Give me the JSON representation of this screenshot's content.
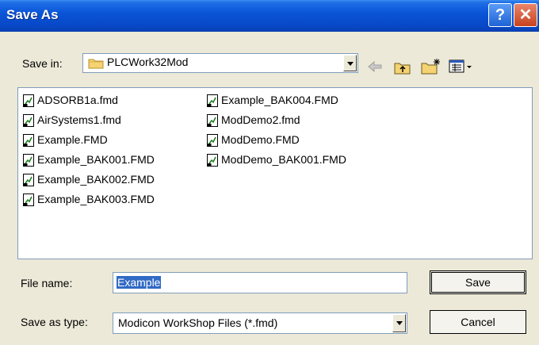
{
  "title": "Save As",
  "titlebar": {
    "help_glyph": "?",
    "close_glyph": "✕"
  },
  "save_in": {
    "label": "Save in:",
    "value": "PLCWork32Mod"
  },
  "files": [
    [
      "ADSORB1a.fmd",
      "AirSystems1.fmd",
      "Example.FMD",
      "Example_BAK001.FMD",
      "Example_BAK002.FMD",
      "Example_BAK003.FMD"
    ],
    [
      "Example_BAK004.FMD",
      "ModDemo2.fmd",
      "ModDemo.FMD",
      "ModDemo_BAK001.FMD"
    ]
  ],
  "file_name": {
    "label": "File name:",
    "value": "Example"
  },
  "save_as_type": {
    "label": "Save as type:",
    "value": "Modicon WorkShop Files (*.fmd)"
  },
  "buttons": {
    "save": "Save",
    "cancel": "Cancel"
  },
  "toolbar_icons": [
    "back-arrow-icon",
    "up-folder-icon",
    "new-folder-icon",
    "view-menu-icon"
  ],
  "colors": {
    "titlebar": "#0a55d8",
    "selection": "#316ac5",
    "dialog_bg": "#ece9d8"
  }
}
